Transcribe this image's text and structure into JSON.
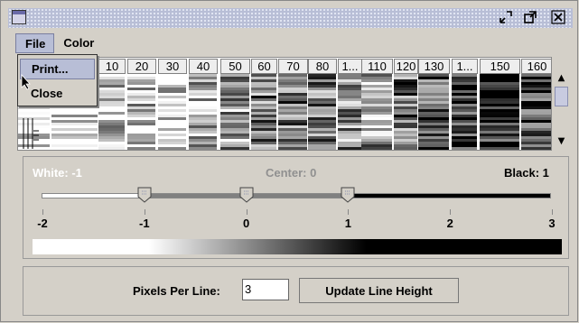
{
  "window": {
    "controls": {
      "iconify_icon": "iconify-icon",
      "maximize_icon": "maximize-icon",
      "close_icon": "close-icon"
    }
  },
  "menubar": {
    "file": "File",
    "color": "Color"
  },
  "file_menu": {
    "print": "Print...",
    "close": "Close"
  },
  "grid": {
    "columns": [
      "10",
      "20",
      "30",
      "40",
      "50",
      "60",
      "70",
      "80",
      "1...",
      "110",
      "120",
      "130",
      "1...",
      "150",
      "160"
    ]
  },
  "contrast": {
    "white_label": "White: -1",
    "center_label": "Center: 0",
    "black_label": "Black: 1",
    "ticks": [
      "-2",
      "-1",
      "0",
      "1",
      "2",
      "3"
    ],
    "slider_values": {
      "white": -1,
      "center": 0,
      "black": 1
    },
    "range": [
      -2,
      3
    ]
  },
  "line_height": {
    "label": "Pixels Per Line:",
    "value": "3",
    "button": "Update Line Height"
  },
  "colors": {
    "titlebar": "#b8bed6",
    "selected_menu": "#b8bed6",
    "background": "#d4d0c8"
  }
}
